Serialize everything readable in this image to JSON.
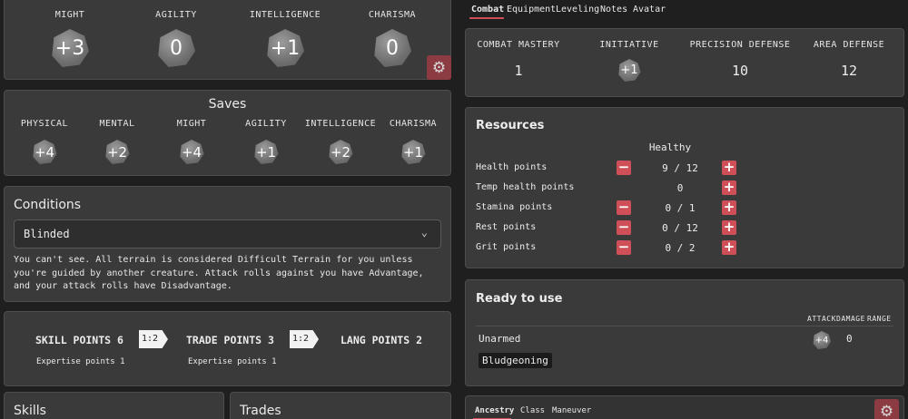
{
  "attributes": [
    {
      "label": "MIGHT",
      "value": "+3"
    },
    {
      "label": "AGILITY",
      "value": "0"
    },
    {
      "label": "INTELLIGENCE",
      "value": "+1"
    },
    {
      "label": "CHARISMA",
      "value": "0"
    }
  ],
  "saves": {
    "title": "Saves",
    "items": [
      {
        "label": "PHYSICAL",
        "value": "+4"
      },
      {
        "label": "MENTAL",
        "value": "+2"
      },
      {
        "label": "MIGHT",
        "value": "+4"
      },
      {
        "label": "AGILITY",
        "value": "+1"
      },
      {
        "label": "INTELLIGENCE",
        "value": "+2"
      },
      {
        "label": "CHARISMA",
        "value": "+1"
      }
    ]
  },
  "conditions": {
    "title": "Conditions",
    "selected": "Blinded",
    "description": "You can't see. All terrain is considered Difficult Terrain for you unless you're guided by another creature. Attack rolls against you have Advantage, and your attack rolls have Disadvantage."
  },
  "points": {
    "skill": "SKILL POINTS 6",
    "skill_sub": "Expertise points 1",
    "ratio1": "1:2",
    "trade": "TRADE POINTS 3",
    "trade_sub": "Expertise points 1",
    "ratio2": "1:2",
    "lang": "LANG POINTS 2"
  },
  "bottom_left": {
    "skills_title": "Skills",
    "trades_title": "Trades"
  },
  "top_tabs": [
    "Combat",
    "Equipment",
    "Leveling",
    "Notes",
    "Avatar"
  ],
  "combat_stats": [
    {
      "label": "COMBAT MASTERY",
      "value": "1"
    },
    {
      "label": "INITIATIVE",
      "value": "+1"
    },
    {
      "label": "PRECISION DEFENSE",
      "value": "10"
    },
    {
      "label": "AREA DEFENSE",
      "value": "12"
    }
  ],
  "resources": {
    "title": "Resources",
    "status": "Healthy",
    "rows": [
      {
        "label": "Health points",
        "value": "9 / 12",
        "minus": true
      },
      {
        "label": "Temp health points",
        "value": "0",
        "minus": false
      },
      {
        "label": "Stamina points",
        "value": "0 / 1",
        "minus": true
      },
      {
        "label": "Rest points",
        "value": "0 / 12",
        "minus": true
      },
      {
        "label": "Grit points",
        "value": "0 / 2",
        "minus": true
      }
    ]
  },
  "ready": {
    "title": "Ready to use",
    "columns": [
      "ATTACK",
      "DAMAGE",
      "RANGE"
    ],
    "weapon": "Unarmed",
    "attack": "+4",
    "damage": "0",
    "tag": "Bludgeoning"
  },
  "bottom_tabs": [
    "Ancestry",
    "Class",
    "Maneuver"
  ],
  "colors": {
    "accent_red": "#cf4f58",
    "gear_red": "#8d3b42",
    "panel": "#3a3a3a",
    "background": "#1f1f1f"
  }
}
